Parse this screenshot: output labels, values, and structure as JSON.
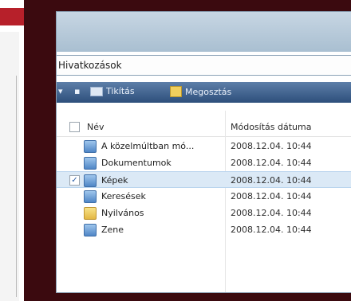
{
  "address": {
    "path": "Hivatkozások"
  },
  "toolbar": {
    "burn_label": "Tikítás",
    "share_label": "Megosztás"
  },
  "columns": {
    "name": "Név",
    "modified": "Módosítás dátuma"
  },
  "rows": [
    {
      "name": "A közelmúltban mó...",
      "modified": "2008.12.04. 10:44",
      "icon": "folder-link-icon"
    },
    {
      "name": "Dokumentumok",
      "modified": "2008.12.04. 10:44",
      "icon": "folder-link-icon"
    },
    {
      "name": "Képek",
      "modified": "2008.12.04. 10:44",
      "icon": "folder-link-icon"
    },
    {
      "name": "Keresések",
      "modified": "2008.12.04. 10:44",
      "icon": "folder-link-icon"
    },
    {
      "name": "Nyilvános",
      "modified": "2008.12.04. 10:44",
      "icon": "folder-link-icon"
    },
    {
      "name": "Zene",
      "modified": "2008.12.04. 10:44",
      "icon": "folder-link-icon"
    }
  ],
  "selected_row": "Képek",
  "colors": {
    "frame": "#3b0a0f",
    "accent_red": "#b7202a",
    "toolbar": "#2d4f7b",
    "selection": "#dbe9f6"
  }
}
